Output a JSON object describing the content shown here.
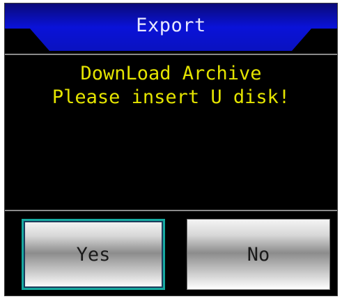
{
  "dialog": {
    "title": "Export",
    "message_lines": [
      "DownLoad Archive",
      "Please insert U disk!"
    ],
    "buttons": {
      "yes_label": "Yes",
      "no_label": "No"
    }
  },
  "colors": {
    "title_bar": "#0a12c8",
    "title_text": "#e8e8ff",
    "message_text": "#e4e400",
    "background": "#000000",
    "focus_border": "#16a9a0"
  }
}
